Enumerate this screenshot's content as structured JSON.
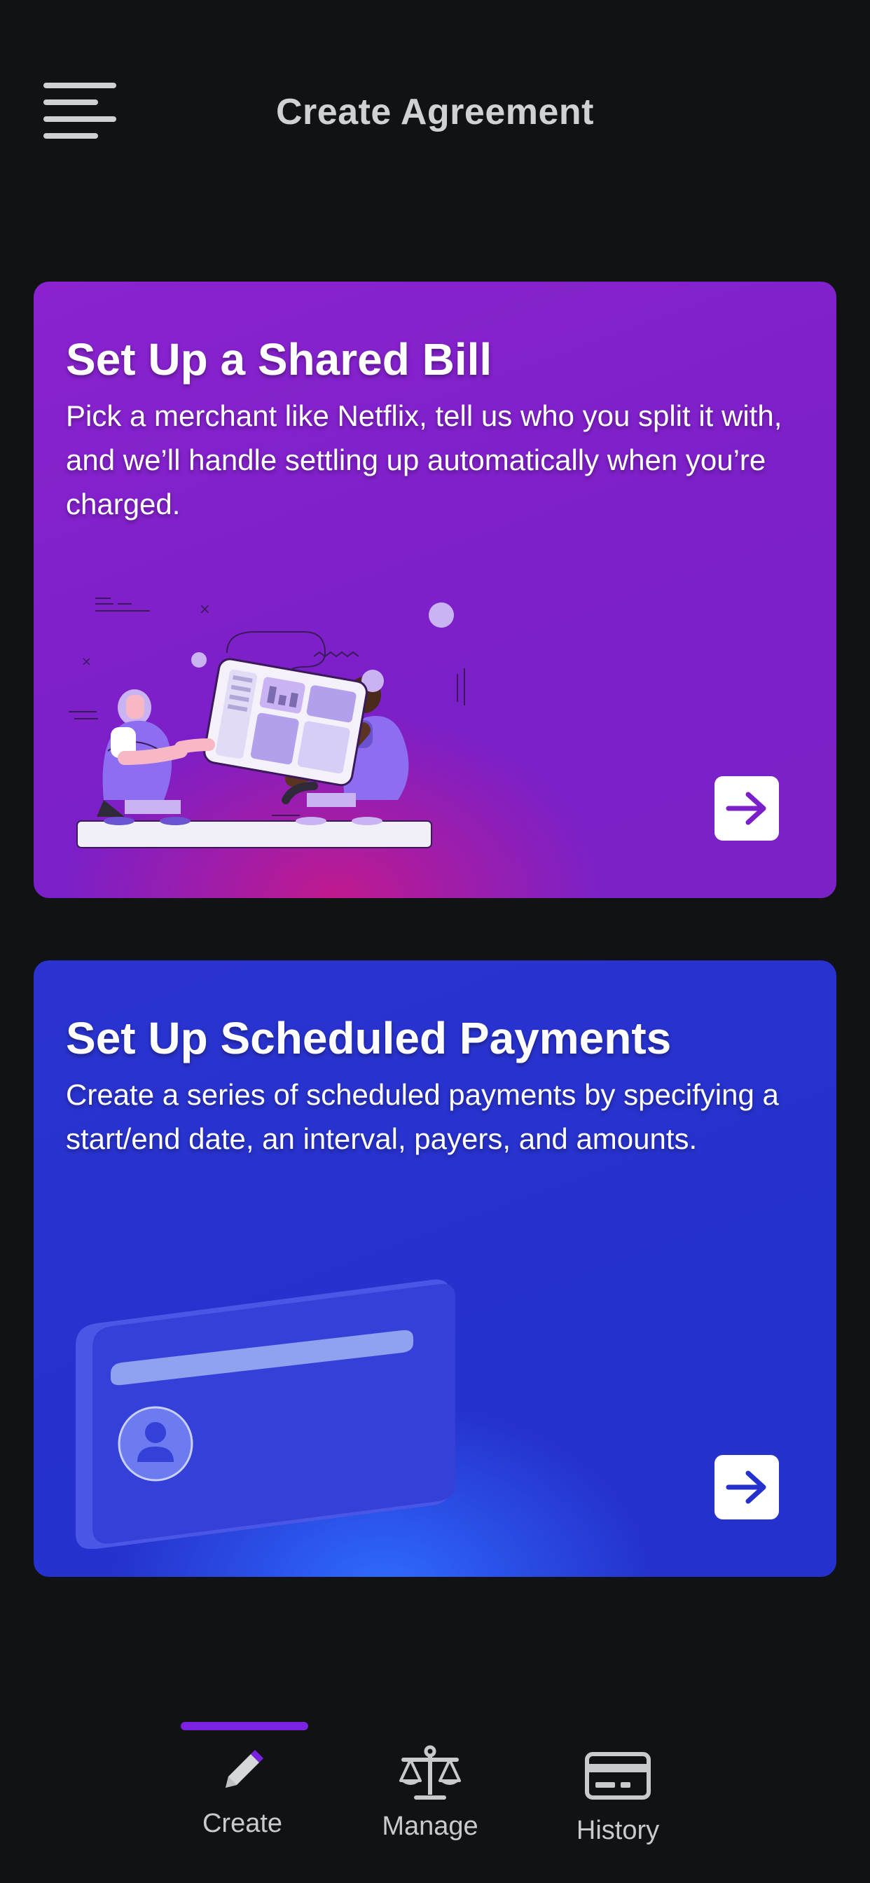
{
  "header": {
    "title": "Create Agreement"
  },
  "cards": [
    {
      "title": "Set Up a Shared Bill",
      "description": "Pick a merchant like Netflix, tell us who you split it with, and we’ll handle settling up automatically when you’re charged.",
      "accent": "#7b1fc8",
      "arrow_color": "#7b1fc8"
    },
    {
      "title": "Set Up Scheduled Payments",
      "description": "Create a series of scheduled payments by specifying a start/end date, an interval, payers, and amounts.",
      "accent": "#2431cc",
      "arrow_color": "#2431cc"
    }
  ],
  "tabs": [
    {
      "label": "Create",
      "icon": "pencil-icon",
      "active": true
    },
    {
      "label": "Manage",
      "icon": "scale-icon",
      "active": false
    },
    {
      "label": "History",
      "icon": "card-icon",
      "active": false
    }
  ],
  "colors": {
    "background": "#111214",
    "active_tab_indicator": "#7a22e0"
  }
}
